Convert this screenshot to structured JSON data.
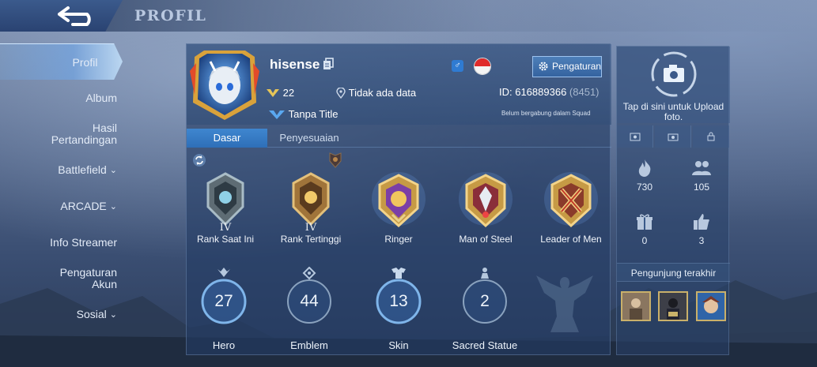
{
  "header": {
    "title": "PROFIL",
    "back_icon": "back-arrow-icon"
  },
  "sidebar": {
    "items": [
      {
        "label": "Profil",
        "active": true
      },
      {
        "label": "Album"
      },
      {
        "label": "Hasil Pertandingan"
      },
      {
        "label": "Battlefield",
        "has_dropdown": true
      },
      {
        "label": "ARCADE",
        "has_dropdown": true
      },
      {
        "label": "Info Streamer"
      },
      {
        "label": "Pengaturan Akun"
      },
      {
        "label": "Sosial",
        "has_dropdown": true
      }
    ]
  },
  "profile": {
    "username": "hisense",
    "level": "22",
    "location": "Tidak ada data",
    "id_label": "ID: 616889366",
    "zone": "(8451)",
    "title": "Tanpa Title",
    "squad_status": "Belum bergabung dalam Squad",
    "settings_label": "Pengaturan",
    "gender": "♂",
    "flag": "Indonesia"
  },
  "tabs": [
    {
      "label": "Dasar",
      "active": true
    },
    {
      "label": "Penyesuaian"
    }
  ],
  "medals": [
    {
      "label": "Rank Saat Ini",
      "roman": "IV"
    },
    {
      "label": "Rank Tertinggi",
      "roman": "IV"
    },
    {
      "label": "Ringer"
    },
    {
      "label": "Man of Steel"
    },
    {
      "label": "Leader of Men"
    }
  ],
  "stats": [
    {
      "label": "Hero",
      "value": "27"
    },
    {
      "label": "Emblem",
      "value": "44"
    },
    {
      "label": "Skin",
      "value": "13"
    },
    {
      "label": "Sacred Statue",
      "value": "2"
    }
  ],
  "right_panel": {
    "upload_text": "Tap di sini untuk Upload foto.",
    "stats": [
      {
        "icon": "fire-icon",
        "value": "730"
      },
      {
        "icon": "friends-icon",
        "value": "105"
      },
      {
        "icon": "gift-icon",
        "value": "0"
      },
      {
        "icon": "thumbs-up-icon",
        "value": "3"
      }
    ],
    "visitors_title": "Pengunjung terakhir"
  },
  "colors": {
    "accent": "#3f86cf",
    "panel": "#23406a",
    "gold": "#c9a24a"
  }
}
